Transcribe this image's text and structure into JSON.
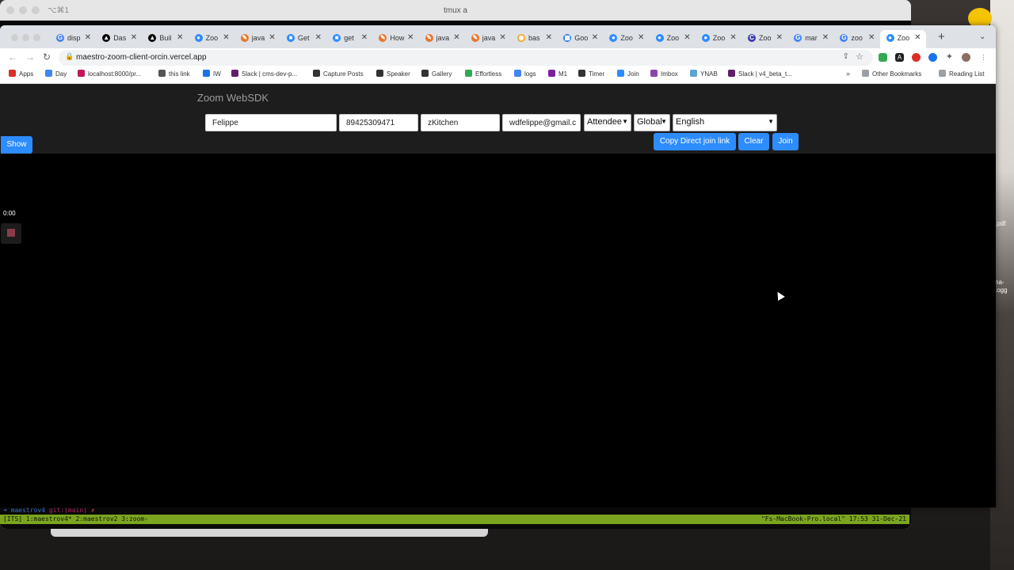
{
  "terminal": {
    "title": "tmux a",
    "shortcut": "⌥⌘1",
    "prompt_arrow": "➜",
    "prompt_dir": "maestrov4",
    "prompt_git": "git:(main)",
    "prompt_x": "✗",
    "tmux_left": "[ITS] 1:maestrov4* 2:maestrov2  3:zoom-",
    "tmux_right": "\"Fs-MacBook-Pro.local\" 17:53 31-Dec-21"
  },
  "desktop": {
    "files": [
      ".pdf",
      "na-",
      ".ogg"
    ]
  },
  "browser": {
    "tabs": [
      {
        "title": "disp",
        "icon": "G",
        "color": "#4285f4"
      },
      {
        "title": "Das",
        "icon": "▲",
        "color": "#000000"
      },
      {
        "title": "Buil",
        "icon": "▲",
        "color": "#000000"
      },
      {
        "title": "Zoo",
        "icon": "●",
        "color": "#2d8cff"
      },
      {
        "title": "java",
        "icon": "✎",
        "color": "#e8762b"
      },
      {
        "title": "Get",
        "icon": "■",
        "color": "#2d8cff"
      },
      {
        "title": "get",
        "icon": "■",
        "color": "#2d8cff"
      },
      {
        "title": "How",
        "icon": "✎",
        "color": "#e8762b"
      },
      {
        "title": "java",
        "icon": "✎",
        "color": "#e8762b"
      },
      {
        "title": "java",
        "icon": "✎",
        "color": "#e8762b"
      },
      {
        "title": "bas",
        "icon": "◉",
        "color": "#f5a623"
      },
      {
        "title": "Goo",
        "icon": "▦",
        "color": "#1a73e8"
      },
      {
        "title": "Zoo",
        "icon": "●",
        "color": "#2d8cff"
      },
      {
        "title": "Zoo",
        "icon": "●",
        "color": "#2d8cff"
      },
      {
        "title": "Zoo",
        "icon": "●",
        "color": "#2d8cff"
      },
      {
        "title": "Zoo",
        "icon": "C",
        "color": "#3c3cb0"
      },
      {
        "title": "mar",
        "icon": "G",
        "color": "#4285f4"
      },
      {
        "title": "zoo",
        "icon": "G",
        "color": "#4285f4"
      },
      {
        "title": "Zoo",
        "icon": "●",
        "color": "#2d8cff",
        "active": true
      }
    ],
    "close_glyph": "✕",
    "new_tab": "+",
    "tab_menu": "⌄",
    "url": "maestro-zoom-client-orcin.vercel.app",
    "bookmarks": [
      {
        "label": "Apps",
        "color": "#d93025"
      },
      {
        "label": "Day",
        "color": "#4285f4"
      },
      {
        "label": "localhost:8000/pr...",
        "color": "#c2185b"
      },
      {
        "label": "this link",
        "color": "#555555"
      },
      {
        "label": "IW",
        "color": "#1a73e8"
      },
      {
        "label": "Slack | cms-dev-p...",
        "color": "#611f69"
      },
      {
        "label": "Capture Posts",
        "color": "#333333"
      },
      {
        "label": "Speaker",
        "color": "#333333"
      },
      {
        "label": "Gallery",
        "color": "#333333"
      },
      {
        "label": "Effortless",
        "color": "#34a853"
      },
      {
        "label": "logs",
        "color": "#4285f4"
      },
      {
        "label": "M1",
        "color": "#7b1fa2"
      },
      {
        "label": "Timer",
        "color": "#333333"
      },
      {
        "label": "Join",
        "color": "#2d8cff"
      },
      {
        "label": "Imbox",
        "color": "#8e44ad"
      },
      {
        "label": "YNAB",
        "color": "#5ba4cf"
      },
      {
        "label": "Slack | v4_beta_t...",
        "color": "#611f69"
      }
    ],
    "bookmarks_more": "»",
    "other_bookmarks": "Other Bookmarks",
    "reading_list": "Reading List"
  },
  "page": {
    "title": "Zoom WebSDK",
    "name_value": "Felippe",
    "meeting_number": "89425309471",
    "password_value": "zKitchen",
    "email_value": "wdfelippe@gmail.c",
    "role_selected": "Attendee",
    "region_selected": "Global",
    "language_selected": "English",
    "copy_link_label": "Copy Direct join link",
    "clear_label": "Clear",
    "join_label": "Join",
    "show_label": "Show",
    "recording_time": "0:00",
    "accent_color": "#2d8cff"
  }
}
